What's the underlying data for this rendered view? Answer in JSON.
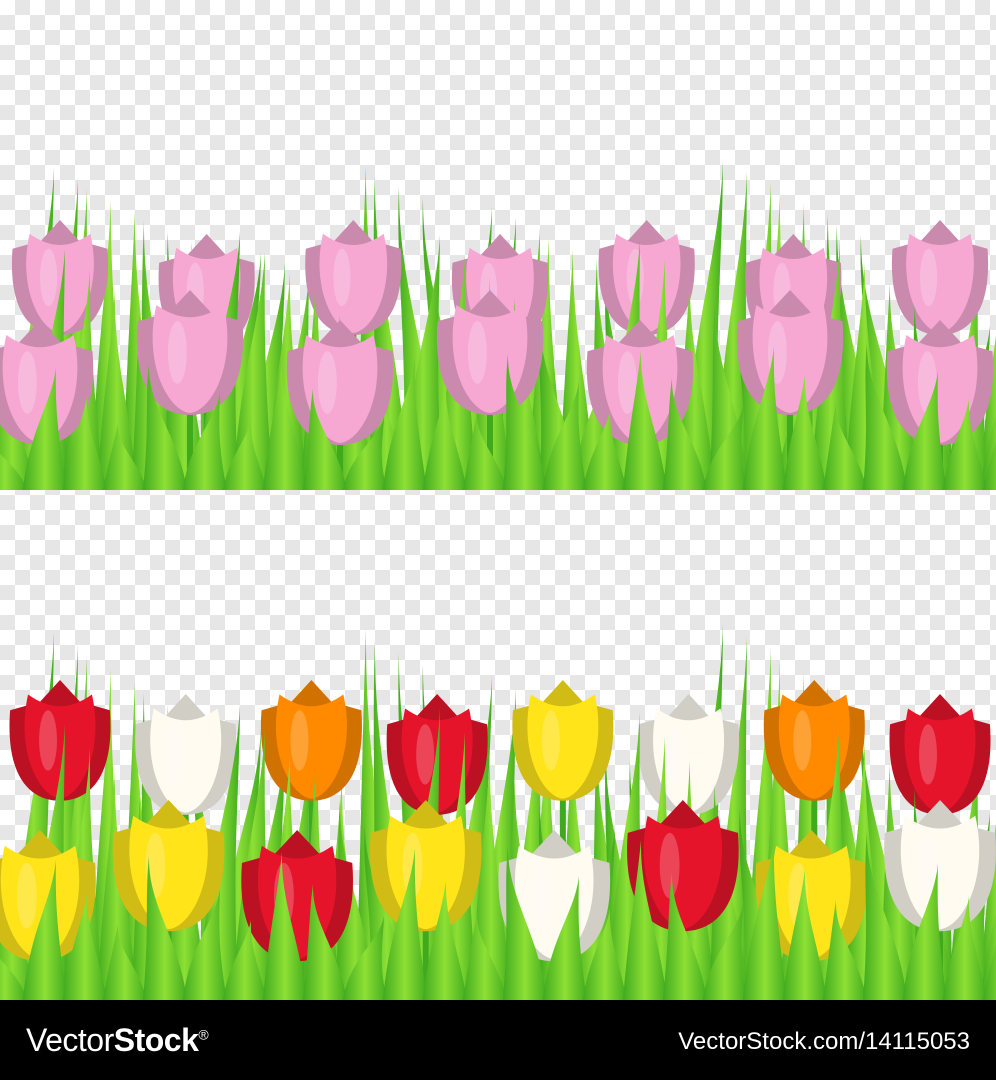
{
  "footer": {
    "brand_light": "Vector",
    "brand_bold": "Stock",
    "brand_tm": "®",
    "stock_id": "VectorStock.com/14115053"
  },
  "colors": {
    "grass_dark": "#3faa1e",
    "grass_light": "#8ee034",
    "pink": "#f6a8d3",
    "red": "#e5142b",
    "yellow": "#ffe419",
    "orange": "#ff8a00",
    "white": "#fffbf1"
  },
  "tulips": {
    "top_row": [
      "pink",
      "pink",
      "pink",
      "pink",
      "pink",
      "pink",
      "pink",
      "pink",
      "pink",
      "pink",
      "pink",
      "pink",
      "pink",
      "pink"
    ],
    "bottom_row": [
      "red",
      "white",
      "orange",
      "red",
      "yellow",
      "white",
      "orange",
      "red",
      "yellow",
      "yellow",
      "red",
      "yellow",
      "white",
      "red",
      "yellow",
      "white"
    ]
  }
}
